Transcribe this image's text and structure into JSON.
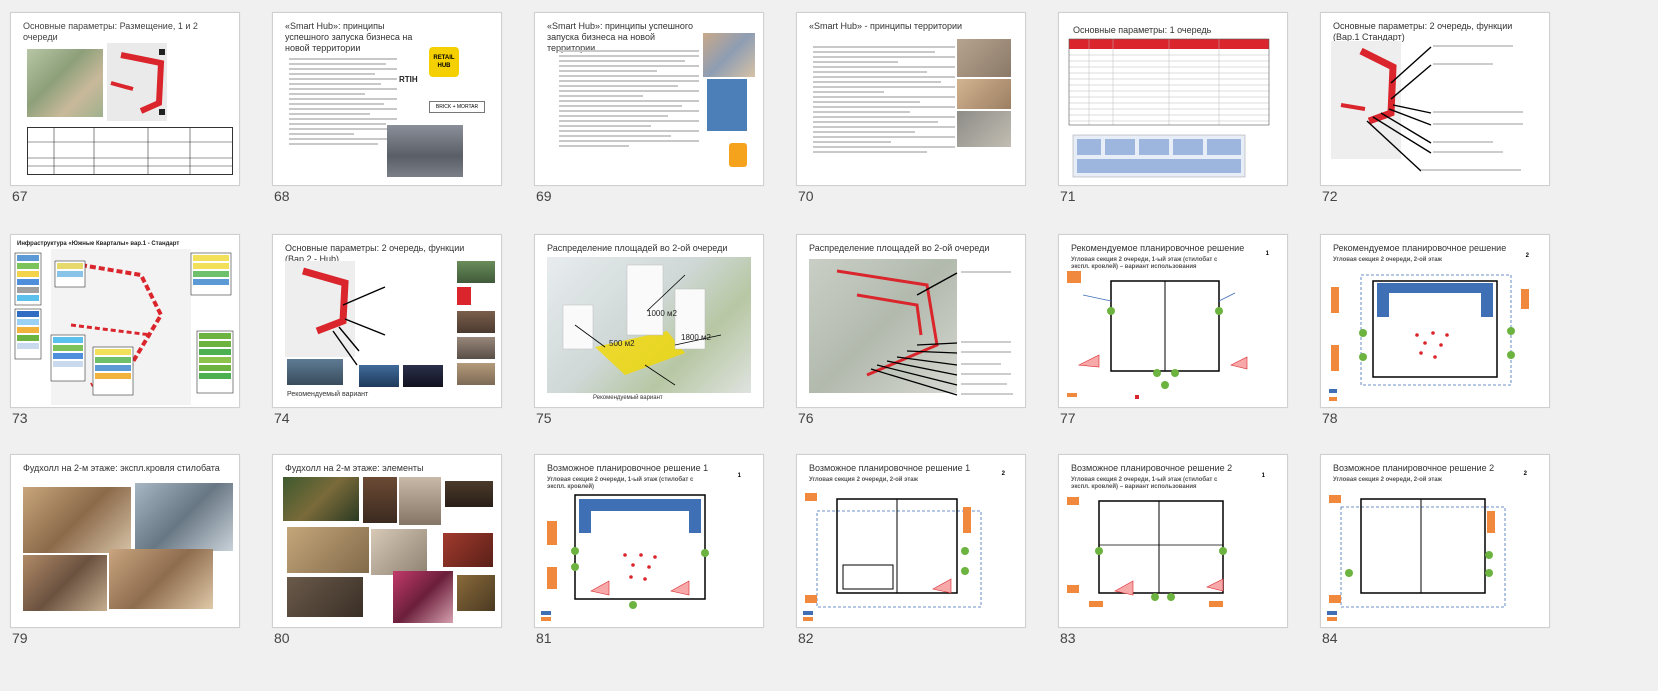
{
  "slides": [
    {
      "num": "67",
      "title": "Основные параметры: Размещение, 1 и 2 очереди"
    },
    {
      "num": "68",
      "title": "«Smart Hub»: принципы успешного запуска бизнеса на новой территории",
      "logos": [
        "RETAIL HUB",
        "RTIH",
        "BRICK + MORTAR"
      ]
    },
    {
      "num": "69",
      "title": "«Smart Hub»: принципы успешного запуска бизнеса на новой территории"
    },
    {
      "num": "70",
      "title": "«Smart Hub» - принципы территории"
    },
    {
      "num": "71",
      "title": "Основные параметры: 1 очередь"
    },
    {
      "num": "72",
      "title": "Основные параметры: 2 очередь, функции (Вар.1   Стандарт)"
    },
    {
      "num": "73",
      "title": "Инфраструктура «Южные Кварталы» вар.1 - Стандарт"
    },
    {
      "num": "74",
      "title": "Основные параметры: 2 очередь, функции (Вар.2 - Hub)",
      "caption": "Рекомендуемый вариант"
    },
    {
      "num": "75",
      "title": "Распределение площадей во 2-ой очереди",
      "labels": [
        "1000 м2",
        "500 м2",
        "1800 м2"
      ],
      "caption": "Рекомендуемый вариант"
    },
    {
      "num": "76",
      "title": "Распределение площадей во 2-ой очереди"
    },
    {
      "num": "77",
      "title": "Рекомендуемое планировочное решение",
      "subtitle": "Угловая секция 2 очереди, 1-ый этаж (стилобат с экспл. кровлей) – вариант использования",
      "page_mark": "1"
    },
    {
      "num": "78",
      "title": "Рекомендуемое планировочное решение",
      "subtitle": "Угловая секция 2 очереди, 2-ой этаж",
      "page_mark": "2"
    },
    {
      "num": "79",
      "title": "Фудхолл на 2-м этаже: экспл.кровля стилобата"
    },
    {
      "num": "80",
      "title": "Фудхолл на 2-м этаже: элементы"
    },
    {
      "num": "81",
      "title": "Возможное планировочное решение 1",
      "subtitle": "Угловая секция 2 очереди, 1-ый этаж (стилобат с экспл. кровлей)",
      "page_mark": "1"
    },
    {
      "num": "82",
      "title": "Возможное планировочное решение 1",
      "subtitle": "Угловая секция 2 очереди, 2-ой этаж",
      "page_mark": "2"
    },
    {
      "num": "83",
      "title": "Возможное планировочное решение 2",
      "subtitle": "Угловая секция 2 очереди, 1-ый этаж (стилобат с экспл. кровлей) – вариант использования",
      "page_mark": "1"
    },
    {
      "num": "84",
      "title": "Возможное планировочное решение 2",
      "subtitle": "Угловая секция 2 очереди, 2-ой этаж",
      "page_mark": "2"
    }
  ],
  "colors": {
    "background": "#f0f0f0",
    "slide_bg": "#ffffff",
    "accent_red": "#d9252b",
    "plan_blue": "#3f6fb5",
    "plan_orange": "#f0883e",
    "tree_green": "#6cb33f"
  }
}
